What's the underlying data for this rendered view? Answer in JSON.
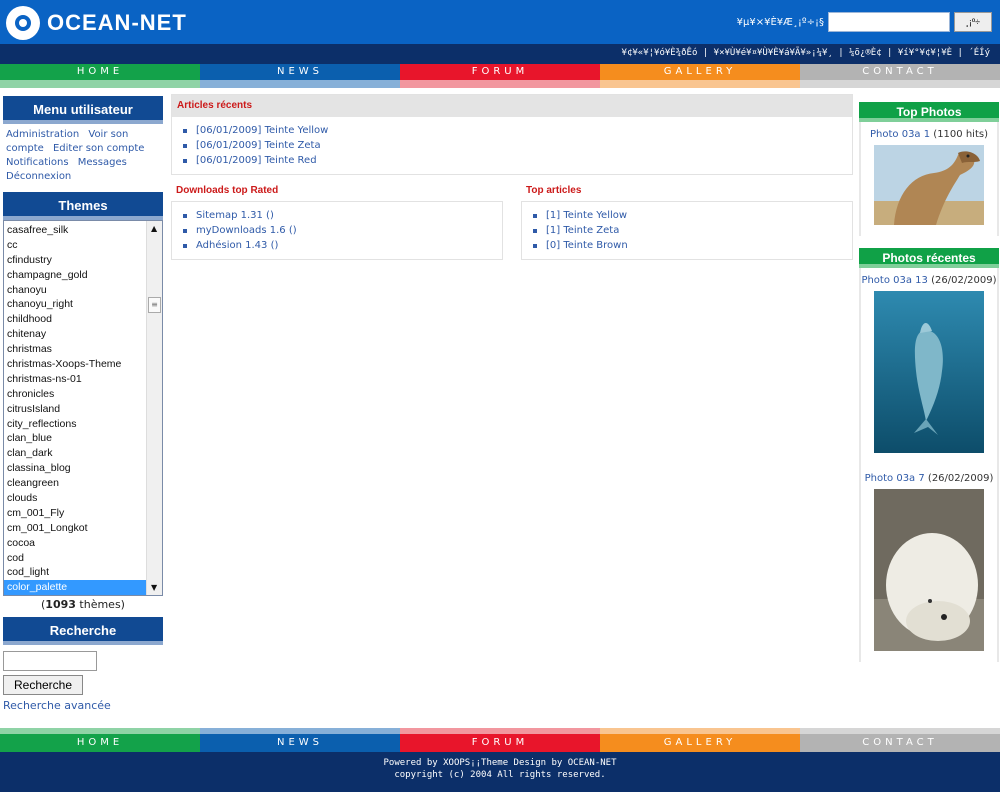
{
  "header": {
    "logo_text": "OCEAN-NET",
    "search_label": "¥µ¥×¥È¥Æ¸¡º÷¡§",
    "search_button": "¸¡º÷",
    "subnav": "¥¢¥«¥¦¥ó¥È¾ðÊó | ¥×¥Ù¥é¥¤¥Ù¥È¥á¥Ã¥»¡¼¥¸ | ¼õ¿®È¢ | ¥í¥°¥¢¥¦¥È | ´ÉÍý"
  },
  "nav": [
    {
      "label": "HOME",
      "color": "#13a24a",
      "stripe": "#8fd3a6"
    },
    {
      "label": "NEWS",
      "color": "#0b5fae",
      "stripe": "#87b0d8"
    },
    {
      "label": "FORUM",
      "color": "#e8152b",
      "stripe": "#f2979f"
    },
    {
      "label": "GALLERY",
      "color": "#f58d1e",
      "stripe": "#f9c590"
    },
    {
      "label": "CONTACT",
      "color": "#b3b3b3",
      "stripe": "#d6d6d6"
    }
  ],
  "sidebar": {
    "user_menu_title": "Menu utilisateur",
    "user_links": [
      "Administration",
      "Voir son compte",
      "Editer son compte",
      "Notifications",
      "Messages",
      "Déconnexion"
    ],
    "themes_title": "Themes",
    "themes": [
      "casafree_silk",
      "cc",
      "cfindustry",
      "champagne_gold",
      "chanoyu",
      "chanoyu_right",
      "childhood",
      "chitenay",
      "christmas",
      "christmas-Xoops-Theme",
      "christmas-ns-01",
      "chronicles",
      "citrusIsland",
      "city_reflections",
      "clan_blue",
      "clan_dark",
      "classina_blog",
      "cleangreen",
      "clouds",
      "cm_001_Fly",
      "cm_001_Longkot",
      "cocoa",
      "cod",
      "cod_light",
      "color_palette"
    ],
    "selected_theme": "color_palette",
    "theme_count_open": "(",
    "theme_count": "1093",
    "theme_count_rest": " thèmes)",
    "search_title": "Recherche",
    "search_button": "Recherche",
    "advanced_search": "Recherche avancée"
  },
  "center": {
    "recent_title": "Articles récents",
    "recent": [
      "[06/01/2009] Teinte Yellow",
      "[06/01/2009] Teinte Zeta",
      "[06/01/2009] Teinte Red"
    ],
    "downloads_title": "Downloads top Rated",
    "downloads": [
      "Sitemap 1.31 ()",
      "myDownloads 1.6 ()",
      "Adhésion 1.43 ()"
    ],
    "top_articles_title": "Top articles",
    "top_articles": [
      "[1] Teinte Yellow",
      "[1] Teinte Zeta",
      "[0] Teinte Brown"
    ]
  },
  "right": {
    "top_photos_title": "Top Photos",
    "top_photo_link": "Photo 03a 1",
    "top_photo_hits": "(1100 hits)",
    "recent_photos_title": "Photos récentes",
    "recent_photo1_link": "Photo 03a 13",
    "recent_photo1_date": "(26/02/2009)",
    "recent_photo2_link": "Photo 03a 7",
    "recent_photo2_date": "(26/02/2009)"
  },
  "footer": {
    "line1": "Powered by XOOPS¡¡Theme Design by OCEAN-NET",
    "line2": "copyright (c) 2004 All rights reserved."
  }
}
